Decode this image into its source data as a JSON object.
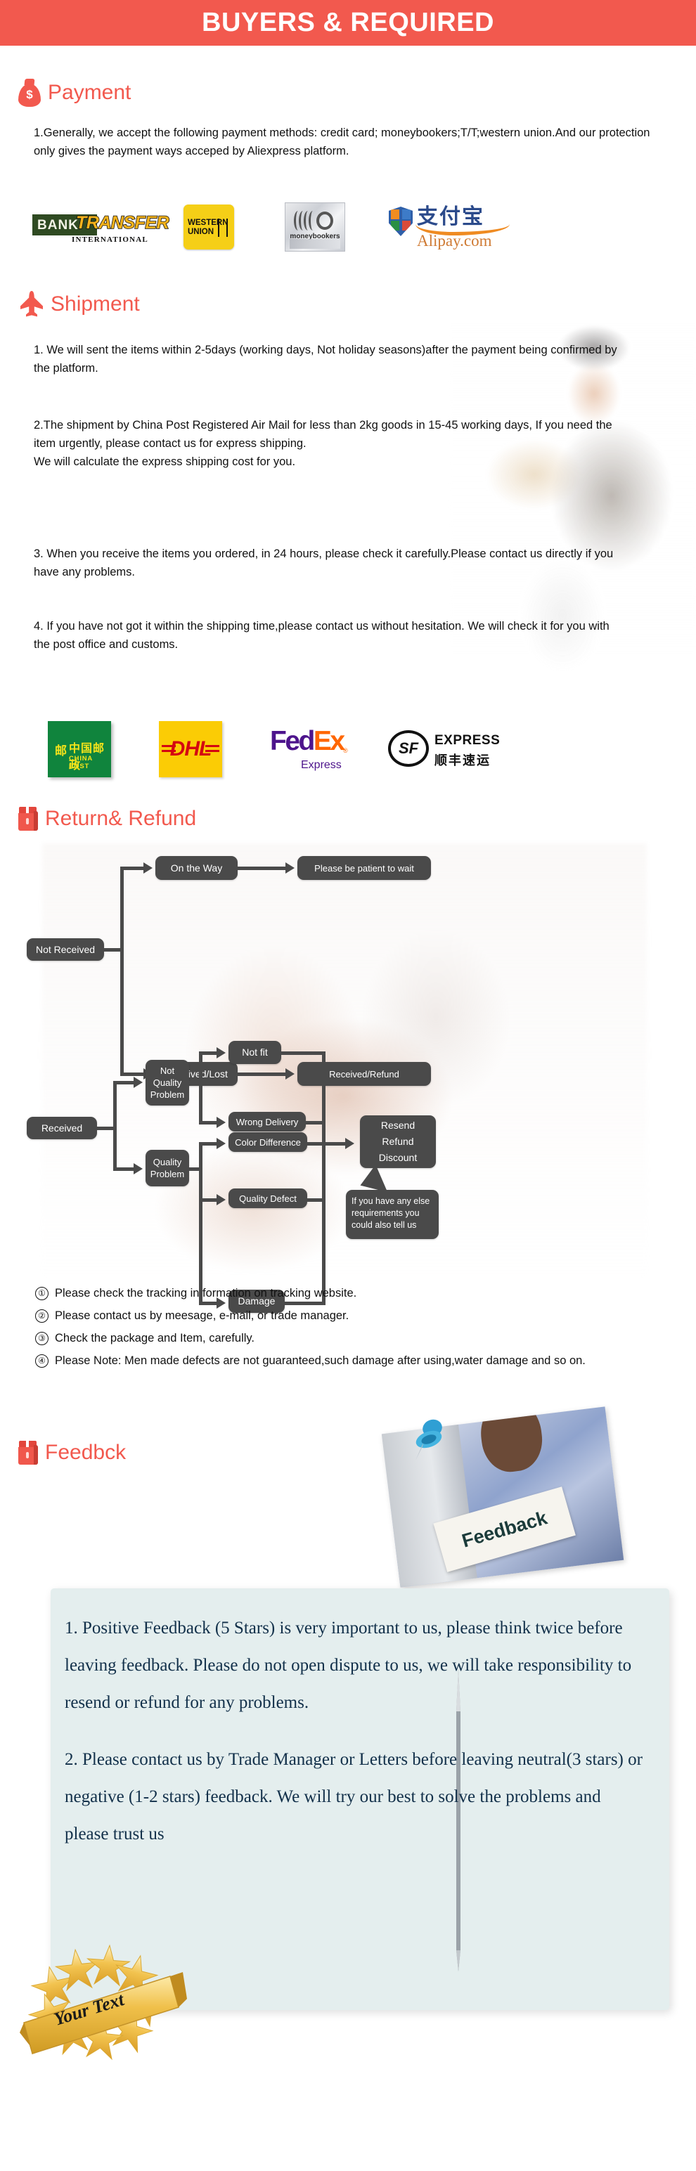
{
  "header": {
    "title": "BUYERS & REQUIRED",
    "bg_color": "#f2594e"
  },
  "sections": {
    "payment": {
      "icon": "money-bag-icon",
      "title": "Payment",
      "paragraph": "1.Generally, we accept the following payment methods: credit card; moneybookers;T/T;western union.And our protection only gives the payment ways acceped by Aliexpress platform.",
      "logos": [
        {
          "name": "bank-transfer",
          "primary": "BANK",
          "secondary": "TRANSFER",
          "tertiary": "INTERNATIONAL"
        },
        {
          "name": "western-union",
          "line1": "WESTERN",
          "line2": "UNION"
        },
        {
          "name": "moneybookers",
          "label": "moneybookers"
        },
        {
          "name": "alipay",
          "zh": "支付宝",
          "label": "Alipay.com"
        }
      ]
    },
    "shipment": {
      "icon": "airplane-icon",
      "title": "Shipment",
      "paragraphs": [
        "1. We will sent the items within 2-5days (working days, Not holiday seasons)after the payment being confirmed by the platform.",
        "2.The shipment by China Post Registered Air Mail for less than  2kg goods in 15-45 working days, If  you need the item urgently, please contact us for express shipping.\nWe will calculate the express shipping cost for you.",
        "3. When you receive the items you ordered, in 24 hours, please check  it carefully.Please contact us directly if you have any problems.",
        "4. If you have not got it within the shipping time,please contact us without hesitation. We will check it for you with the post office and customs."
      ],
      "carriers": [
        {
          "name": "china-post",
          "zh": "中国邮政",
          "en": "CHINA POST"
        },
        {
          "name": "dhl",
          "label": "DHL"
        },
        {
          "name": "fedex",
          "part1": "Fed",
          "part2": "Ex",
          "sub": "Express"
        },
        {
          "name": "sf-express",
          "badge": "SF",
          "en": "EXPRESS",
          "zh": "顺丰速运"
        }
      ]
    },
    "return_refund": {
      "icon": "box-icon",
      "title": "Return& Refund",
      "flow_nodes": {
        "not_received": "Not Received",
        "on_the_way": "On the Way",
        "please_wait": "Please be patient to wait",
        "received_lost": "Received/Lost",
        "received_refund": "Received/Refund",
        "received": "Received",
        "not_quality_problem": "Not\nQuality\nProblem",
        "quality_problem": "Quality\nProblem",
        "not_fit": "Not fit",
        "wrong_delivery": "Wrong Delivery",
        "color_difference": "Color Difference",
        "quality_defect": "Quality Defect",
        "damage": "Damage",
        "resend_refund_discount": "Resend\nRefund\nDiscount",
        "else_requirements": "If you have any else\nrequirements you\ncould also tell us"
      },
      "notes": [
        {
          "marker": "①",
          "text": "Please check the tracking in formation on tracking website."
        },
        {
          "marker": "②",
          "text": "Please contact us by meesage, e-mail, or trade manager."
        },
        {
          "marker": "③",
          "text": "Check the package and Item, carefully."
        },
        {
          "marker": "④",
          "text": "Please Note: Men made defects  are not guaranteed,such damage after using,water damage and so on."
        }
      ]
    },
    "feedback": {
      "icon": "box-icon",
      "title": "Feedbck",
      "photo_sign_label": "Feedback",
      "paragraphs": [
        "1. Positive Feedback (5 Stars) is very important to us, please think twice before leaving feedback. Please do not open dispute to us,   we will take responsibility to resend or refund for any problems.",
        "2. Please contact us by Trade Manager or Letters before leaving neutral(3 stars) or negative (1-2 stars) feedback. We will try our best to solve the problems and please trust us"
      ],
      "badge_label": "Your Text",
      "panel_color": "#e4eeee"
    }
  }
}
